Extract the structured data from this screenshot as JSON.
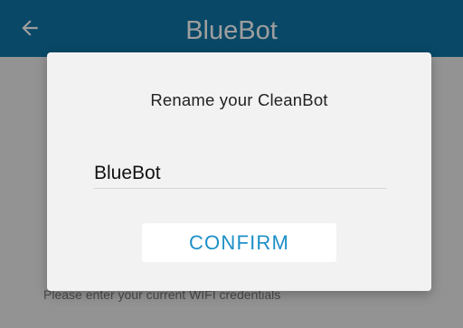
{
  "app_bar": {
    "title": "BlueBot",
    "back_icon": "arrow-left-icon",
    "color": "#0f74a6"
  },
  "body": {
    "helper_text": "Please enter your current WIFI credentials"
  },
  "dialog": {
    "title": "Rename your CleanBot",
    "name_value": "BlueBot",
    "confirm_label": "CONFIRM",
    "accent_color": "#1e8fc7"
  }
}
